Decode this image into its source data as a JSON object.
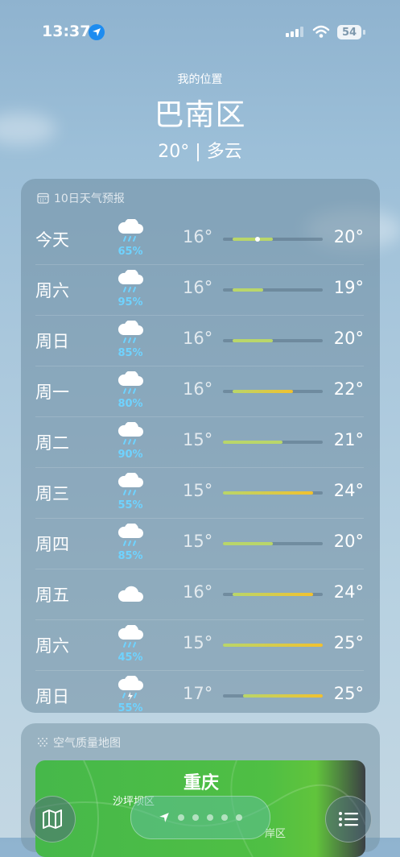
{
  "status_bar": {
    "time": "13:37",
    "battery": "54"
  },
  "header": {
    "subtitle": "我的位置",
    "city": "巴南区",
    "condition": "20° | 多云"
  },
  "forecast": {
    "title": "10日天气预报",
    "range_min": 15,
    "range_max": 25,
    "days": [
      {
        "day": "今天",
        "icon": "cloud-rain-icon",
        "precip": "65%",
        "low": "16°",
        "high": "20°",
        "low_v": 16,
        "high_v": 20,
        "current": 18.5
      },
      {
        "day": "周六",
        "icon": "cloud-rain-icon",
        "precip": "95%",
        "low": "16°",
        "high": "19°",
        "low_v": 16,
        "high_v": 19
      },
      {
        "day": "周日",
        "icon": "cloud-rain-icon",
        "precip": "85%",
        "low": "16°",
        "high": "20°",
        "low_v": 16,
        "high_v": 20
      },
      {
        "day": "周一",
        "icon": "cloud-rain-icon",
        "precip": "80%",
        "low": "16°",
        "high": "22°",
        "low_v": 16,
        "high_v": 22
      },
      {
        "day": "周二",
        "icon": "cloud-rain-icon",
        "precip": "90%",
        "low": "15°",
        "high": "21°",
        "low_v": 15,
        "high_v": 21
      },
      {
        "day": "周三",
        "icon": "cloud-rain-icon",
        "precip": "55%",
        "low": "15°",
        "high": "24°",
        "low_v": 15,
        "high_v": 24
      },
      {
        "day": "周四",
        "icon": "cloud-rain-icon",
        "precip": "85%",
        "low": "15°",
        "high": "20°",
        "low_v": 15,
        "high_v": 20
      },
      {
        "day": "周五",
        "icon": "cloud-icon",
        "precip": "",
        "low": "16°",
        "high": "24°",
        "low_v": 16,
        "high_v": 24
      },
      {
        "day": "周六",
        "icon": "cloud-rain-icon",
        "precip": "45%",
        "low": "15°",
        "high": "25°",
        "low_v": 15,
        "high_v": 25
      },
      {
        "day": "周日",
        "icon": "cloud-bolt-rain-icon",
        "precip": "55%",
        "low": "17°",
        "high": "25°",
        "low_v": 17,
        "high_v": 25
      }
    ]
  },
  "air_quality": {
    "title": "空气质量地图",
    "map_city": "重庆",
    "map_district": "沙坪坝区",
    "map_district2": "岸区"
  },
  "colors": {
    "cool": "#b9d66a",
    "warm": "#f2c12e",
    "precip": "#6fd3ff"
  }
}
